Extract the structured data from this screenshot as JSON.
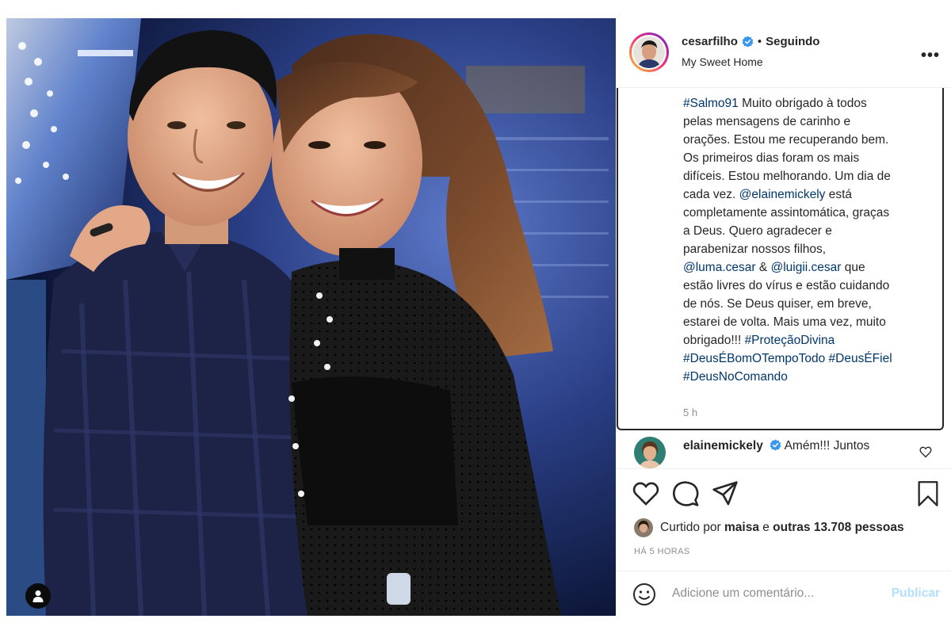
{
  "post": {
    "username": "cesarfilho",
    "dot": "•",
    "follow_status": "Seguindo",
    "location": "My Sweet Home",
    "more_label": "•••"
  },
  "caption": {
    "lines": [
      [
        {
          "t": "#Salmo91",
          "tag": true
        },
        {
          "t": " Muito obrigado à todos"
        }
      ],
      [
        {
          "t": "pelas mensagens de carinho e"
        }
      ],
      [
        {
          "t": "orações. Estou me recuperando bem."
        }
      ],
      [
        {
          "t": "Os primeiros dias foram os mais"
        }
      ],
      [
        {
          "t": "difíceis. Estou melhorando. Um dia de"
        }
      ],
      [
        {
          "t": "cada vez. "
        },
        {
          "t": "@elainemickely",
          "tag": true
        },
        {
          "t": " está"
        }
      ],
      [
        {
          "t": "completamente assintomática, graças"
        }
      ],
      [
        {
          "t": "a Deus. Quero agradecer e"
        }
      ],
      [
        {
          "t": "parabenizar nossos filhos,"
        }
      ],
      [
        {
          "t": "@luma.cesar",
          "tag": true
        },
        {
          "t": " & "
        },
        {
          "t": "@luigii.cesar",
          "tag": true
        },
        {
          "t": " que"
        }
      ],
      [
        {
          "t": "estão livres do vírus e estão cuidando"
        }
      ],
      [
        {
          "t": "de nós. Se Deus quiser, em breve,"
        }
      ],
      [
        {
          "t": "estarei de volta. Mais uma vez, muito"
        }
      ],
      [
        {
          "t": "obrigado!!! "
        },
        {
          "t": "#ProteçãoDivina",
          "tag": true
        }
      ],
      [
        {
          "t": "#DeusÉBomOTempoTodo",
          "tag": true
        },
        {
          "t": " "
        },
        {
          "t": "#DeusÉFiel",
          "tag": true
        }
      ],
      [
        {
          "t": "#DeusNoComando",
          "tag": true
        }
      ]
    ],
    "time": "5 h"
  },
  "comment": {
    "username": "elainemickely",
    "text": " Amém!!! Juntos"
  },
  "likes": {
    "prefix": "Curtido por ",
    "user": "maisa",
    "middle": " e ",
    "count_text": "outras 13.708 pessoas"
  },
  "time_ago": "HÁ 5 HORAS",
  "add_comment": {
    "placeholder": "Adicione um comentário...",
    "publish_label": "Publicar"
  },
  "colors": {
    "verified": "#3897f0",
    "hashtag": "#00376b",
    "publish_disabled": "#b2dffc",
    "meta_gray": "#8e8e8e"
  }
}
